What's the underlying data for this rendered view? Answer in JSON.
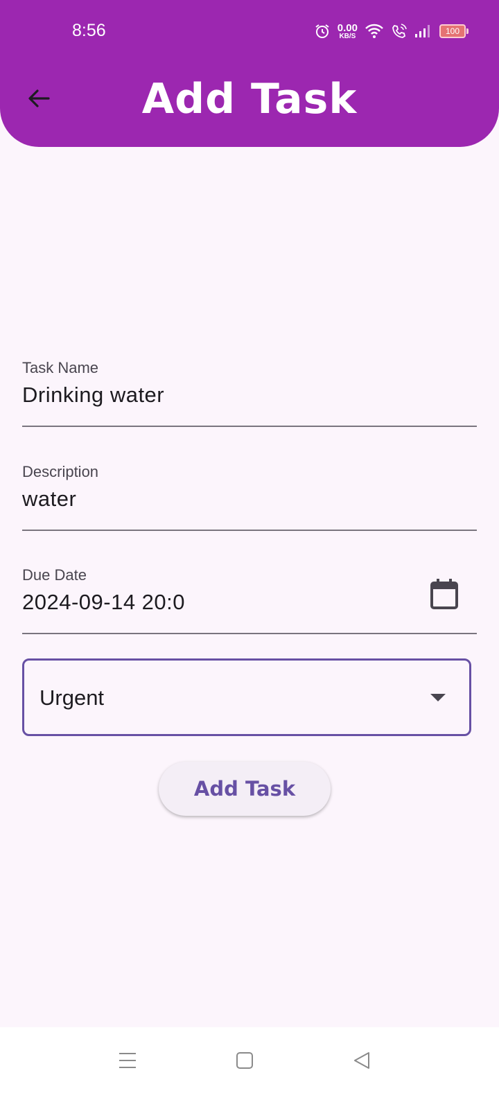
{
  "status_bar": {
    "time": "8:56",
    "net_speed_value": "0.00",
    "net_speed_unit": "KB/S",
    "battery": "100"
  },
  "header": {
    "title": "Add Task",
    "accent_color": "#9c27b0"
  },
  "form": {
    "task_name": {
      "label": "Task Name",
      "value": "Drinking water"
    },
    "description": {
      "label": "Description",
      "value": "water"
    },
    "due_date": {
      "label": "Due Date",
      "value": "2024-09-14 20:0"
    },
    "priority": {
      "selected": "Urgent"
    },
    "submit_label": "Add Task"
  },
  "icons": {
    "back": "arrow-back-icon",
    "calendar": "calendar-icon",
    "dropdown": "dropdown-arrow-icon",
    "nav_menu": "menu-icon",
    "nav_home": "home-square-icon",
    "nav_back": "back-triangle-icon"
  }
}
